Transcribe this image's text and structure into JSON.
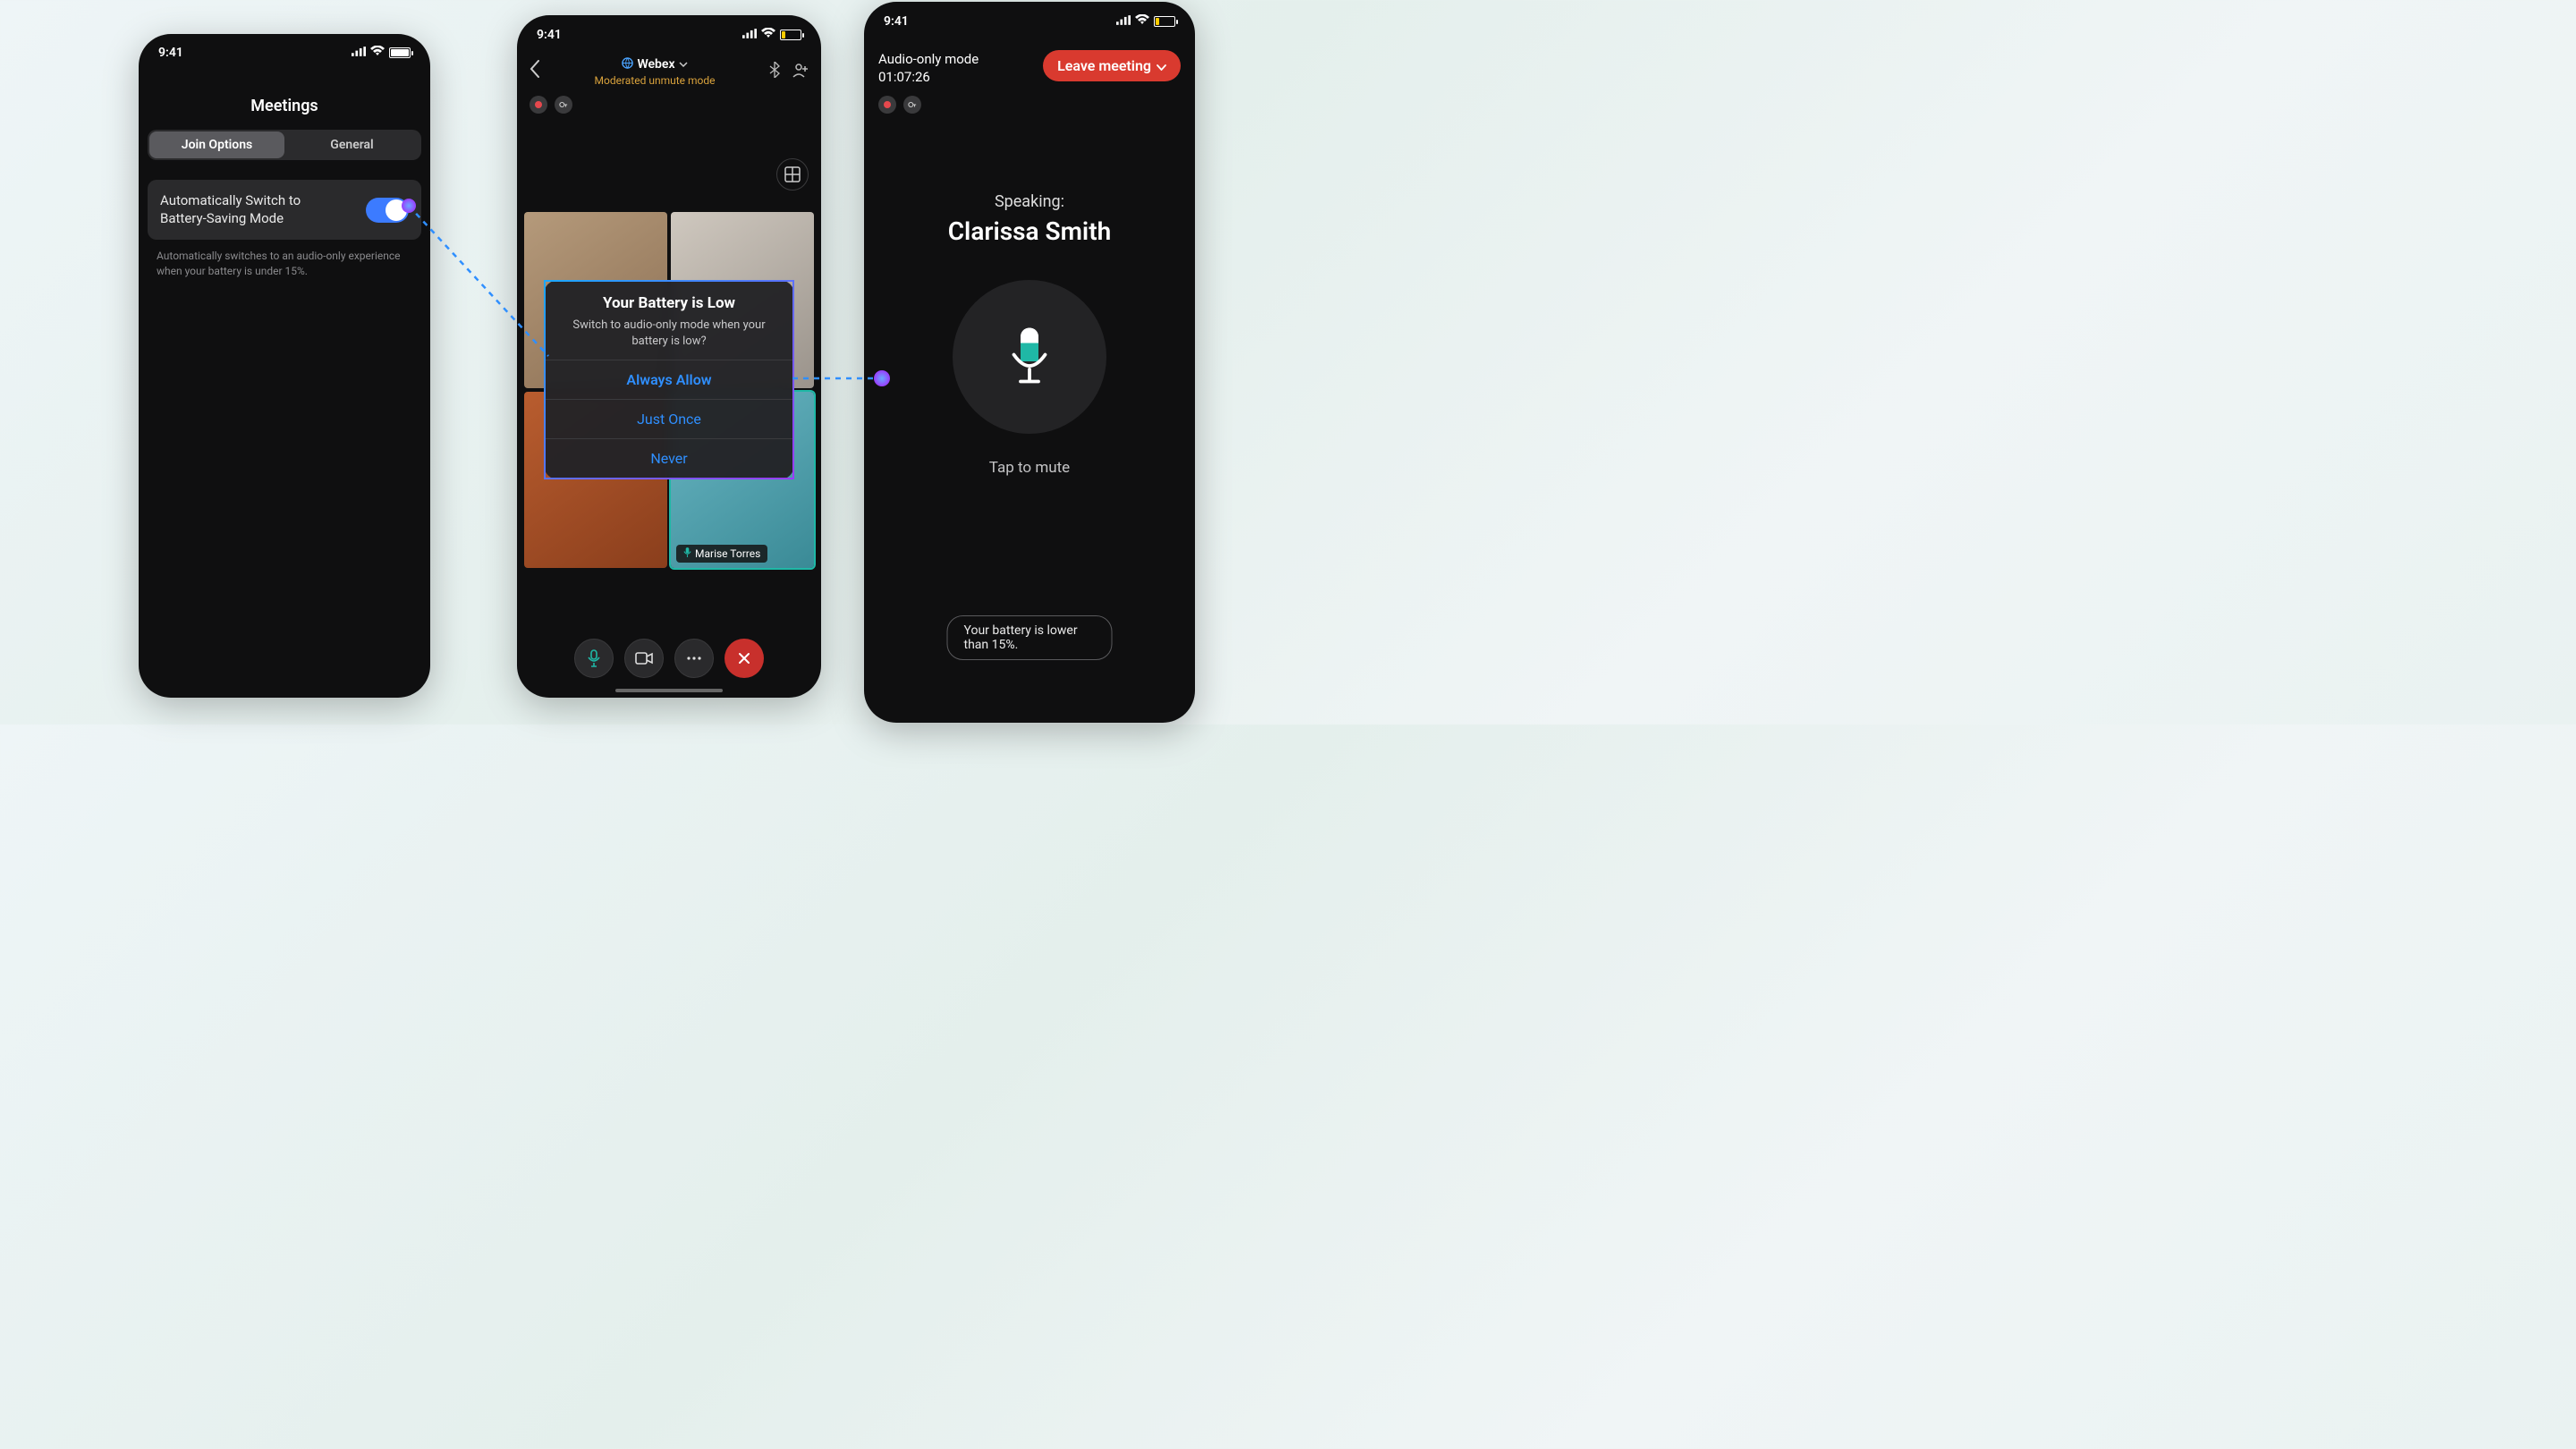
{
  "status_time": "9:41",
  "phone1": {
    "title": "Meetings",
    "tabs": [
      "Join Options",
      "General"
    ],
    "setting_label": "Automatically Switch to Battery-Saving Mode",
    "setting_desc": "Automatically switches to an audio-only experience when your battery is under 15%."
  },
  "phone2": {
    "app_title": "Webex",
    "subtitle": "Moderated unmute mode",
    "participant_name": "Marise Torres",
    "dialog": {
      "title": "Your Battery is Low",
      "message": "Switch to audio-only mode when your battery is low?",
      "options": [
        "Always Allow",
        "Just Once",
        "Never"
      ]
    }
  },
  "phone3": {
    "mode_label": "Audio-only mode",
    "duration": "01:07:26",
    "leave_label": "Leave meeting",
    "speaking_label": "Speaking:",
    "speaker_name": "Clarissa Smith",
    "tap_label": "Tap to mute",
    "toast": "Your battery is lower than 15%."
  }
}
